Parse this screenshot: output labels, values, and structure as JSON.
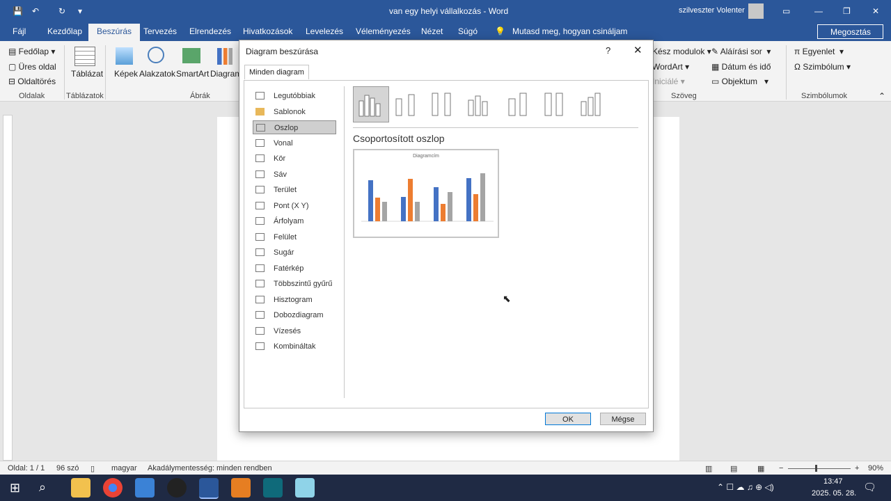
{
  "window": {
    "title": "van egy helyi vállalkozás - Word",
    "user": "szilveszter Volenter"
  },
  "tabs": [
    "Fájl",
    "Kezdőlap",
    "Beszúrás",
    "Tervezés",
    "Elrendezés",
    "Hivatkozások",
    "Levelezés",
    "Véleményezés",
    "Nézet",
    "Súgó"
  ],
  "search_hint": "Mutasd meg, hogyan csináljam",
  "share_label": "Megosztás",
  "ribbon": {
    "pages": [
      "Fedőlap",
      "Üres oldal",
      "Oldaltörés"
    ],
    "pages_group": "Oldalak",
    "table": "Táblázat",
    "table_group": "Táblázatok",
    "images": "Képek",
    "shapes": "Alakzatok",
    "smartart": "SmartArt",
    "chart": "Diagram",
    "illustrations_group": "Ábrák",
    "text_items": [
      "Kész modulok",
      "WordArt",
      "Iniciálé",
      "Aláírási sor",
      "Dátum és idő",
      "Objektum"
    ],
    "text_group": "Szöveg",
    "symbol_items": [
      "Egyenlet",
      "Szimbólum"
    ],
    "symbols_group": "Szimbólumok"
  },
  "dialog": {
    "title": "Diagram beszúrása",
    "help": "?",
    "tab": "Minden diagram",
    "categories": [
      "Legutóbbiak",
      "Sablonok",
      "Oszlop",
      "Vonal",
      "Kör",
      "Sáv",
      "Terület",
      "Pont (X Y)",
      "Árfolyam",
      "Felület",
      "Sugár",
      "Fatérkép",
      "Többszintű gyűrű",
      "Hisztogram",
      "Dobozdiagram",
      "Vízesés",
      "Kombináltak"
    ],
    "selected_category": "Oszlop",
    "subtype_title": "Csoportosított oszlop",
    "preview_title": "Diagramcím",
    "ok": "OK",
    "cancel": "Mégse"
  },
  "status": {
    "page": "Oldal: 1 / 1",
    "words": "96 szó",
    "language": "magyar",
    "accessibility": "Akadálymentesség: minden rendben",
    "zoom": "90%"
  },
  "clock": {
    "time": "13:47",
    "date": "2025. 05. 28."
  },
  "colors": {
    "word_blue": "#2b579a",
    "series1": "#4472c4",
    "series2": "#ed7d31",
    "series3": "#a5a5a5"
  }
}
